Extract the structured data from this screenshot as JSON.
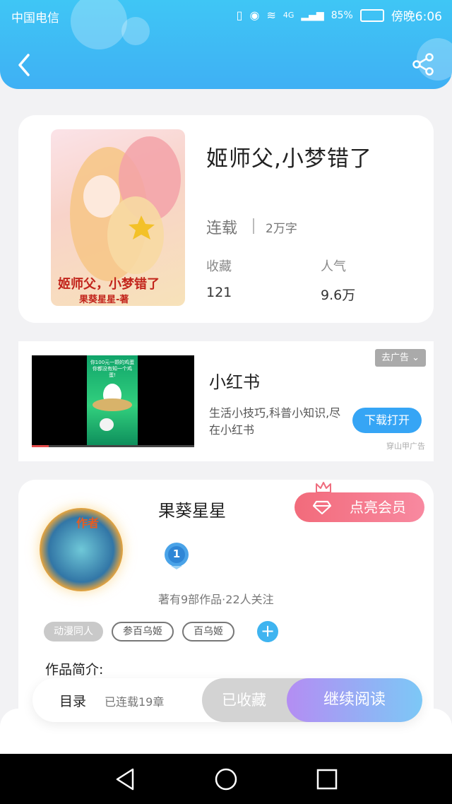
{
  "status_bar": {
    "carrier": "中国电信",
    "battery": "85%",
    "time": "傍晚6:06",
    "network": "4G"
  },
  "header": {
    "back_icon": "back-arrow-icon",
    "share_icon": "share-icon",
    "color": "#3fc6f5"
  },
  "book": {
    "title": "姬师父,小梦错了",
    "status": "连载",
    "words": "2万字",
    "favorites_label": "收藏",
    "favorites_value": "121",
    "popularity_label": "人气",
    "popularity_value": "9.6万",
    "cover_title": "姬师父，小梦错了",
    "cover_author": "果葵星星-著"
  },
  "ad": {
    "tag": "去广告",
    "title": "小红书",
    "description": "生活小技巧,科普小知识,尽在小红书",
    "button": "下载打开",
    "source": "穿山甲广告",
    "video_caption": "你100元一颗的鸡蛋 你都没有知一个鸡蛋!"
  },
  "author": {
    "name": "果葵星星",
    "avatar_badge": "作者",
    "vip_button": "点亮会员",
    "medal_number": "1",
    "stats": "著有9部作品·22人关注",
    "tags": [
      "动漫同人",
      "参百乌姬",
      "百乌姬"
    ],
    "intro_label": "作品简介:"
  },
  "action_bar": {
    "toc": "目录",
    "chapters": "已连载19章",
    "favorite": "已收藏",
    "read": "继续阅读"
  },
  "nav": {
    "back_icon": "nav-back-icon",
    "home_icon": "nav-home-icon",
    "recent_icon": "nav-recent-icon"
  }
}
